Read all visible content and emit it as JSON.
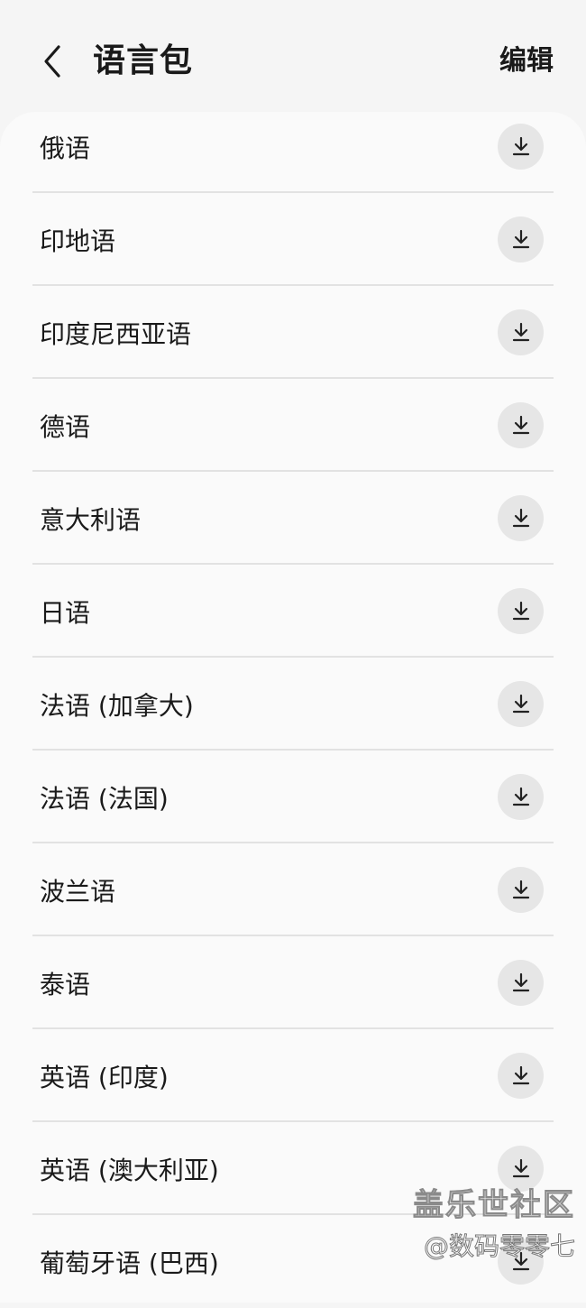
{
  "header": {
    "title": "语言包",
    "edit_label": "编辑",
    "back_icon": "chevron-left-icon"
  },
  "languages": [
    {
      "label": "俄语",
      "icon": "download-icon"
    },
    {
      "label": "印地语",
      "icon": "download-icon"
    },
    {
      "label": "印度尼西亚语",
      "icon": "download-icon"
    },
    {
      "label": "德语",
      "icon": "download-icon"
    },
    {
      "label": "意大利语",
      "icon": "download-icon"
    },
    {
      "label": "日语",
      "icon": "download-icon"
    },
    {
      "label": "法语 (加拿大)",
      "icon": "download-icon"
    },
    {
      "label": "法语 (法国)",
      "icon": "download-icon"
    },
    {
      "label": "波兰语",
      "icon": "download-icon"
    },
    {
      "label": "泰语",
      "icon": "download-icon"
    },
    {
      "label": "英语 (印度)",
      "icon": "download-icon"
    },
    {
      "label": "英语 (澳大利亚)",
      "icon": "download-icon"
    },
    {
      "label": "葡萄牙语 (巴西)",
      "icon": "download-icon"
    }
  ],
  "watermark": {
    "line1": "盖乐世社区",
    "line2": "@数码零零七"
  },
  "colors": {
    "background": "#f5f5f5",
    "card": "#fafafa",
    "button_bg": "#e6e6e6",
    "divider": "#e2e2e2",
    "text": "#1a1a1a"
  }
}
